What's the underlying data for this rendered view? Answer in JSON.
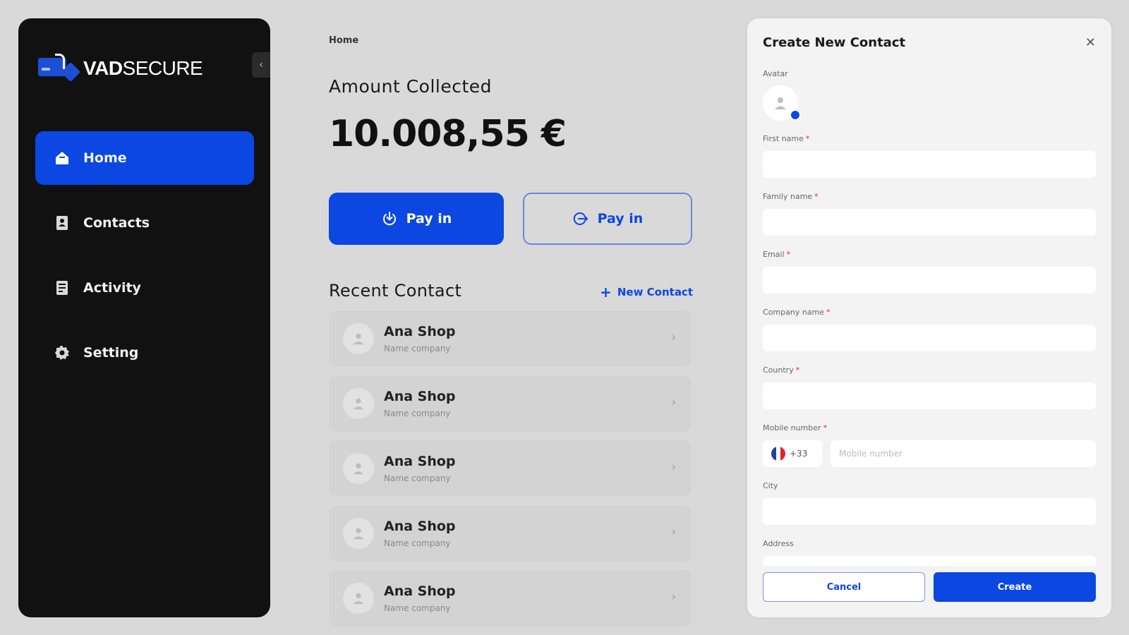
{
  "brand": {
    "name_bold": "VAD",
    "name_light": "SECURE",
    "primary_color": "#0b47e0",
    "sidebar_color": "#111111"
  },
  "sidebar": {
    "items": [
      {
        "label": "Home",
        "icon": "home-icon",
        "active": true
      },
      {
        "label": "Contacts",
        "icon": "contacts-icon",
        "active": false
      },
      {
        "label": "Activity",
        "icon": "activity-icon",
        "active": false
      },
      {
        "label": "Setting",
        "icon": "gear-icon",
        "active": false
      }
    ]
  },
  "main": {
    "breadcrumb": "Home",
    "amount_label": "Amount Collected",
    "amount_value": "10.008,55 €",
    "pay_in_primary": "Pay in",
    "pay_in_secondary": "Pay in",
    "recent_title": "Recent Contact",
    "new_contact": "New Contact",
    "contacts": [
      {
        "name": "Ana Shop",
        "company": "Name company"
      },
      {
        "name": "Ana Shop",
        "company": "Name company"
      },
      {
        "name": "Ana Shop",
        "company": "Name company"
      },
      {
        "name": "Ana Shop",
        "company": "Name company"
      },
      {
        "name": "Ana Shop",
        "company": "Name company"
      }
    ]
  },
  "panel": {
    "title": "Create New Contact",
    "avatar_label": "Avatar",
    "fields": {
      "first_name": {
        "label": "First name",
        "required": "*",
        "value": ""
      },
      "family_name": {
        "label": "Family name",
        "required": "*",
        "value": ""
      },
      "email": {
        "label": "Email",
        "required": "*",
        "value": ""
      },
      "company_name": {
        "label": "Company name",
        "required": "*",
        "value": ""
      },
      "country": {
        "label": "Country",
        "required": "*",
        "value": ""
      },
      "mobile": {
        "label": "Mobile number",
        "required": "*",
        "dial_code": "+33",
        "placeholder": "Mobile number",
        "value": ""
      },
      "city": {
        "label": "City",
        "value": ""
      },
      "address": {
        "label": "Address",
        "value": ""
      }
    },
    "cancel_label": "Cancel",
    "create_label": "Create"
  }
}
